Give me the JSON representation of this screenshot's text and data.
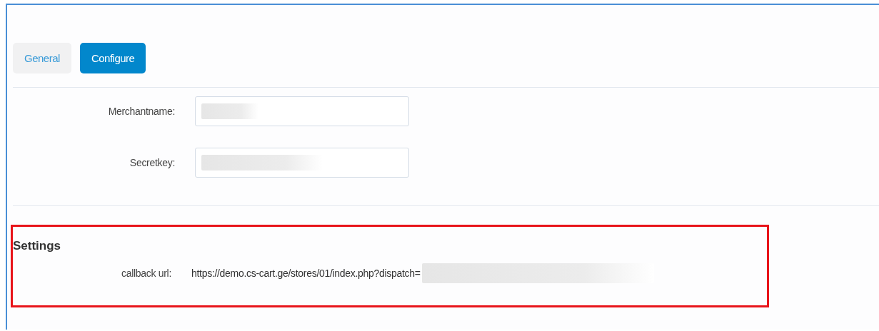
{
  "tabs": [
    {
      "label": "General",
      "selected": false
    },
    {
      "label": "Configure",
      "selected": true
    }
  ],
  "fields": [
    {
      "label": "Merchantname:",
      "redacted": true
    },
    {
      "label": "Secretkey:",
      "redacted": true
    }
  ],
  "settings": {
    "heading": "Settings",
    "highlighted": true,
    "rows": [
      {
        "label": "callback url:",
        "value": "https://demo.cs-cart.ge/stores/01/index.php?dispatch=",
        "redacted": true
      }
    ]
  }
}
